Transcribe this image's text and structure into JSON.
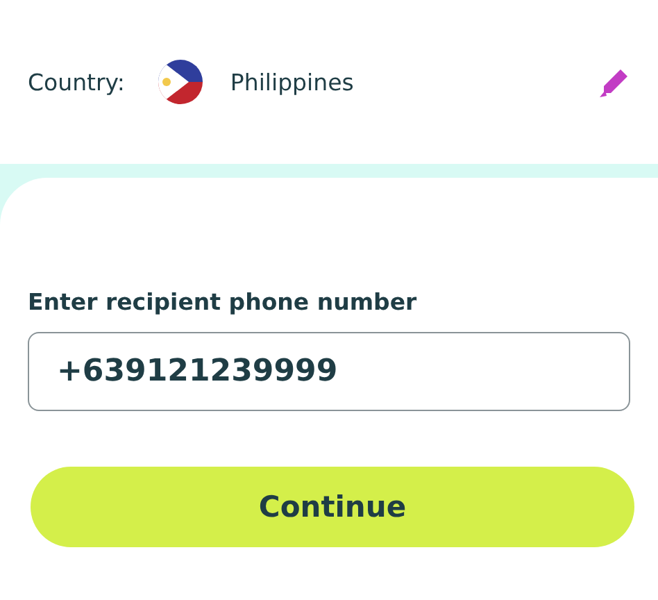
{
  "country": {
    "label": "Country:",
    "name": "Philippines"
  },
  "phone": {
    "label": "Enter recipient phone number",
    "value": "+639121239999"
  },
  "button": {
    "label": "Continue"
  }
}
